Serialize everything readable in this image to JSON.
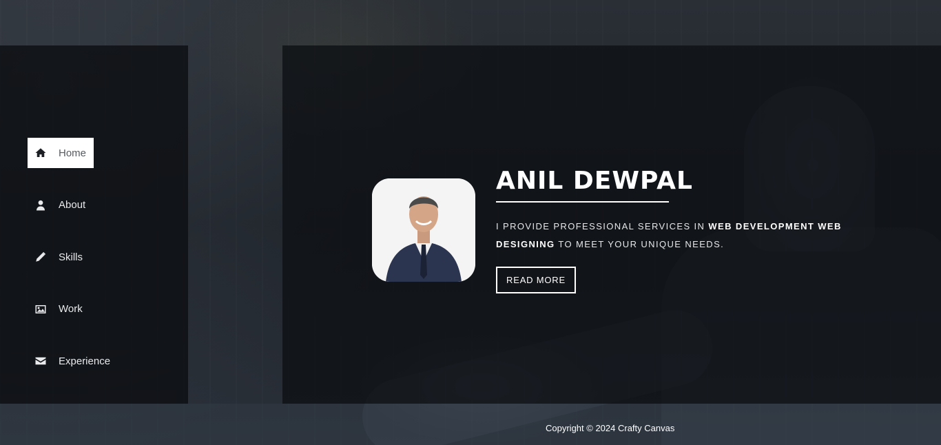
{
  "nav": {
    "items": [
      {
        "label": "Home",
        "icon": "home-icon",
        "active": true
      },
      {
        "label": "About",
        "icon": "user-icon",
        "active": false
      },
      {
        "label": "Skills",
        "icon": "pencil-icon",
        "active": false
      },
      {
        "label": "Work",
        "icon": "image-icon",
        "active": false
      },
      {
        "label": "Experience",
        "icon": "envelope-icon",
        "active": false
      }
    ]
  },
  "hero": {
    "name": "ANIL DEWPAL",
    "tagline_prefix": "I provide professional services in ",
    "tagline_highlight": "WEB DEVELOPMENT WEB DESIGNING",
    "tagline_suffix": " to meet your unique needs.",
    "cta_label": "READ MORE"
  },
  "footer": {
    "copyright": "Copyright © 2024 Crafty Canvas"
  },
  "colors": {
    "panel_bg": "#0e1014",
    "accent_text": "#ffffff",
    "active_nav_bg": "#ffffff"
  }
}
